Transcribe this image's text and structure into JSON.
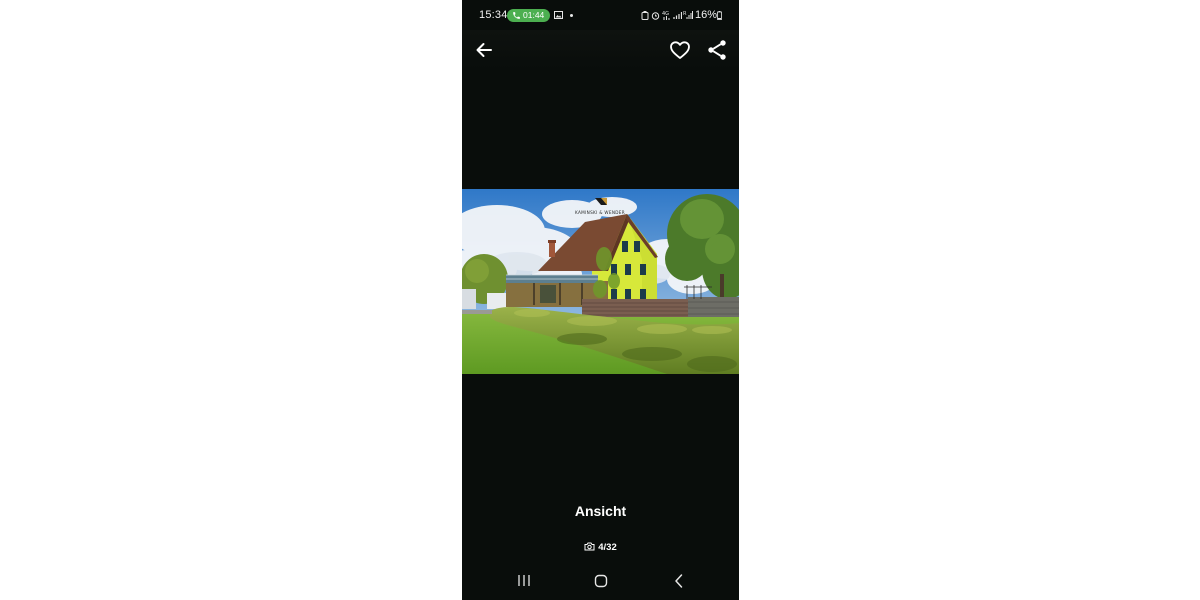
{
  "status_bar": {
    "time": "15:34",
    "call_duration": "01:44",
    "battery_percent": "16%"
  },
  "toolbar": {
    "back_icon": "arrow-left-icon",
    "favorite_icon": "heart-outline-icon",
    "share_icon": "share-icon"
  },
  "photo": {
    "subject": "house-exterior-photo",
    "watermark_text": "KAMINSKI & WENDER"
  },
  "caption": {
    "title": "Ansicht"
  },
  "counter": {
    "icon": "camera-icon",
    "text": "4/32"
  },
  "navigation_bar": {
    "recents_icon": "recents-icon",
    "home_icon": "home-icon",
    "back_icon": "back-chevron-icon"
  },
  "colors": {
    "background": "#090d0b",
    "call_pill": "#4caf50",
    "text": "#ffffff"
  }
}
